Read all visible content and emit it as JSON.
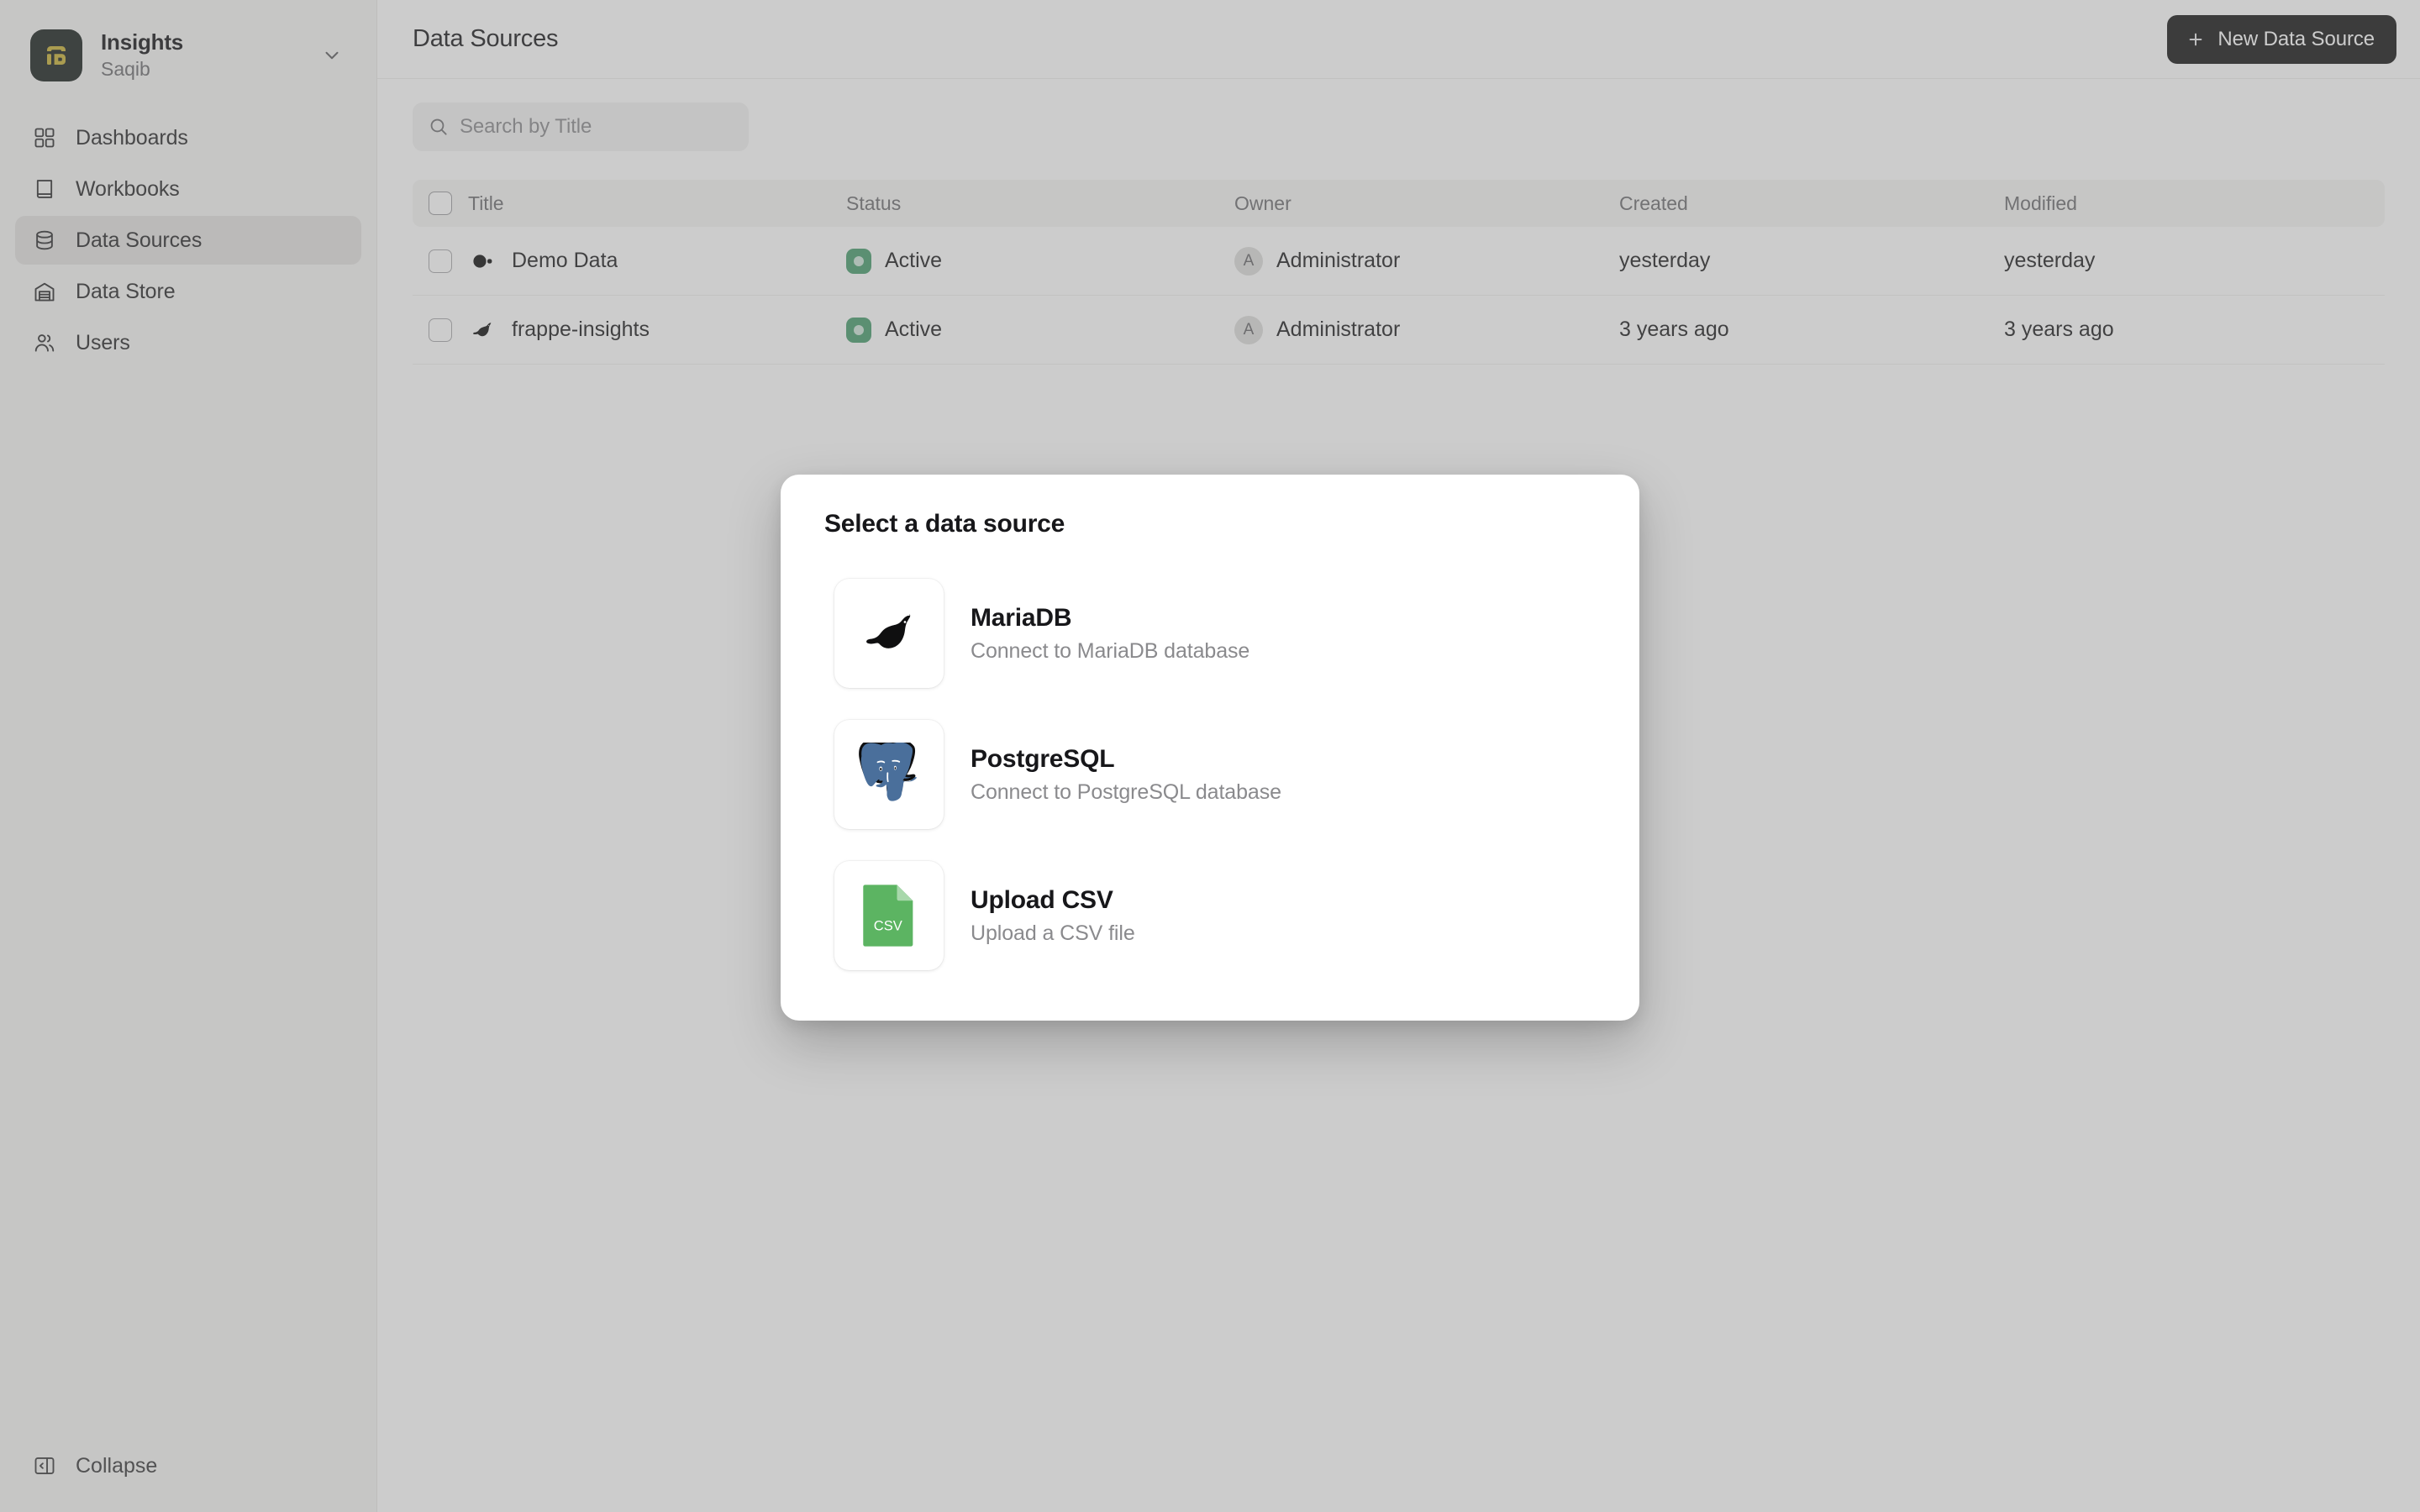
{
  "sidebar": {
    "brand": {
      "logo_icon": "insights-logo-icon",
      "title": "Insights",
      "subtitle": "Saqib",
      "chevron_icon": "chevron-down-icon"
    },
    "items": [
      {
        "label": "Dashboards",
        "icon": "grid-icon",
        "active": false
      },
      {
        "label": "Workbooks",
        "icon": "book-icon",
        "active": false
      },
      {
        "label": "Data Sources",
        "icon": "database-icon",
        "active": true
      },
      {
        "label": "Data Store",
        "icon": "warehouse-icon",
        "active": false
      },
      {
        "label": "Users",
        "icon": "users-icon",
        "active": false
      }
    ],
    "collapse": {
      "label": "Collapse",
      "icon": "sidebar-collapse-icon"
    }
  },
  "header": {
    "title": "Data Sources",
    "new_button": {
      "label": "New Data Source",
      "icon": "plus-icon"
    }
  },
  "search": {
    "placeholder": "Search by Title",
    "value": "",
    "icon": "search-icon"
  },
  "table": {
    "columns": [
      "Title",
      "Status",
      "Owner",
      "Created",
      "Modified"
    ],
    "rows": [
      {
        "icon": "frappe-logo-icon",
        "title": "Demo Data",
        "status": "Active",
        "status_color": "#4a9d6e",
        "owner": "Administrator",
        "owner_initial": "A",
        "created": "yesterday",
        "modified": "yesterday"
      },
      {
        "icon": "mariadb-seal-icon",
        "title": "frappe-insights",
        "status": "Active",
        "status_color": "#4a9d6e",
        "owner": "Administrator",
        "owner_initial": "A",
        "created": "3 years ago",
        "modified": "3 years ago"
      }
    ]
  },
  "modal": {
    "title": "Select a data source",
    "options": [
      {
        "icon": "mariadb-seal-icon",
        "name": "MariaDB",
        "description": "Connect to MariaDB database"
      },
      {
        "icon": "postgresql-elephant-icon",
        "name": "PostgreSQL",
        "description": "Connect to PostgreSQL database"
      },
      {
        "icon": "csv-file-icon",
        "name": "Upload CSV",
        "description": "Upload a CSV file"
      }
    ]
  },
  "colors": {
    "brand_logo_bg": "#1b2220",
    "brand_logo_fg": "#c9b237",
    "primary_button_bg": "#171717",
    "status_active": "#4a9d6e",
    "csv_green": "#5cb462",
    "postgres_blue": "#336791",
    "sidebar_bg": "#f5f5f4"
  }
}
